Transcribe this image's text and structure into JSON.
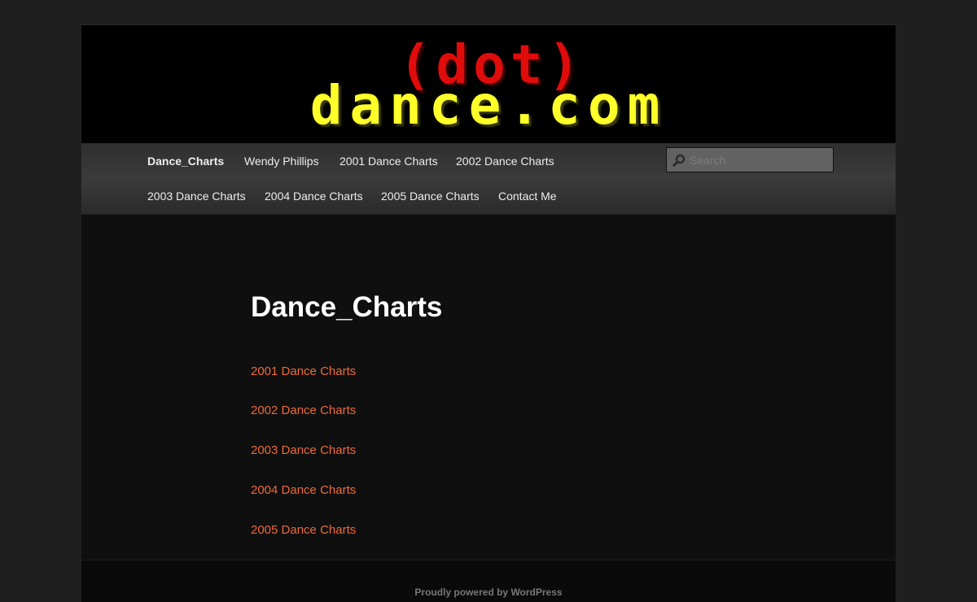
{
  "header": {
    "logo_top": "(dot)",
    "logo_bottom": "dance.com",
    "logo_top_color": "#e00b0b",
    "logo_bottom_color": "#ffff2a"
  },
  "nav": {
    "items": [
      {
        "label": "Dance_Charts",
        "current": true
      },
      {
        "label": "Wendy Phillips"
      },
      {
        "label": "2001 Dance Charts"
      },
      {
        "label": "2002 Dance Charts"
      },
      {
        "label": "2003 Dance Charts"
      },
      {
        "label": "2004 Dance Charts"
      },
      {
        "label": "2005 Dance Charts"
      },
      {
        "label": "Contact Me"
      }
    ],
    "search": {
      "placeholder": "Search",
      "value": "",
      "icon": "search-icon"
    }
  },
  "content": {
    "title": "Dance_Charts",
    "links": [
      "2001 Dance Charts",
      "2002 Dance Charts",
      "2003 Dance Charts",
      "2004 Dance Charts",
      "2005 Dance Charts"
    ],
    "link_color": "#ee6a3a"
  },
  "footer": {
    "credit": "Proudly powered by WordPress"
  }
}
